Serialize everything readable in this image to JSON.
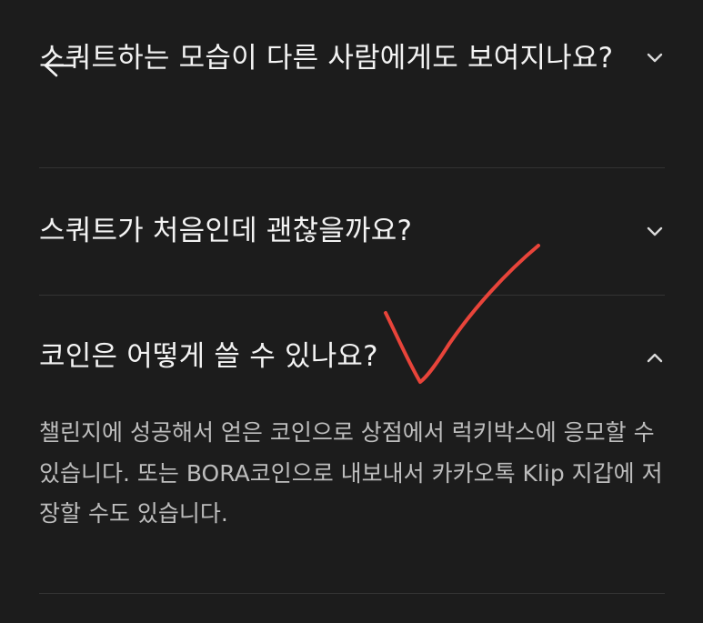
{
  "faq": {
    "items": [
      {
        "question": "스쿼트하는 모습이 다른 사람에게도 보여지나요?",
        "expanded": false
      },
      {
        "question": "스쿼트가 처음인데 괜찮을까요?",
        "expanded": false
      },
      {
        "question": "코인은 어떻게 쓸 수 있나요?",
        "expanded": true,
        "answer": "챌린지에 성공해서 얻은 코인으로 상점에서 럭키박스에 응모할 수 있습니다. 또는 BORA코인으로 내보내서 카카오톡 Klip 지갑에 저장할 수도 있습니다."
      }
    ]
  },
  "icons": {
    "back": "back-arrow-icon",
    "collapsed": "chevron-down-icon",
    "expanded": "chevron-up-icon"
  },
  "colors": {
    "background": "#1c1c1c",
    "question_text": "#f3f3f3",
    "answer_text": "#bdbdbd",
    "divider": "#333333",
    "chevron": "#d9d9d9",
    "annotation": "#e8443a"
  }
}
